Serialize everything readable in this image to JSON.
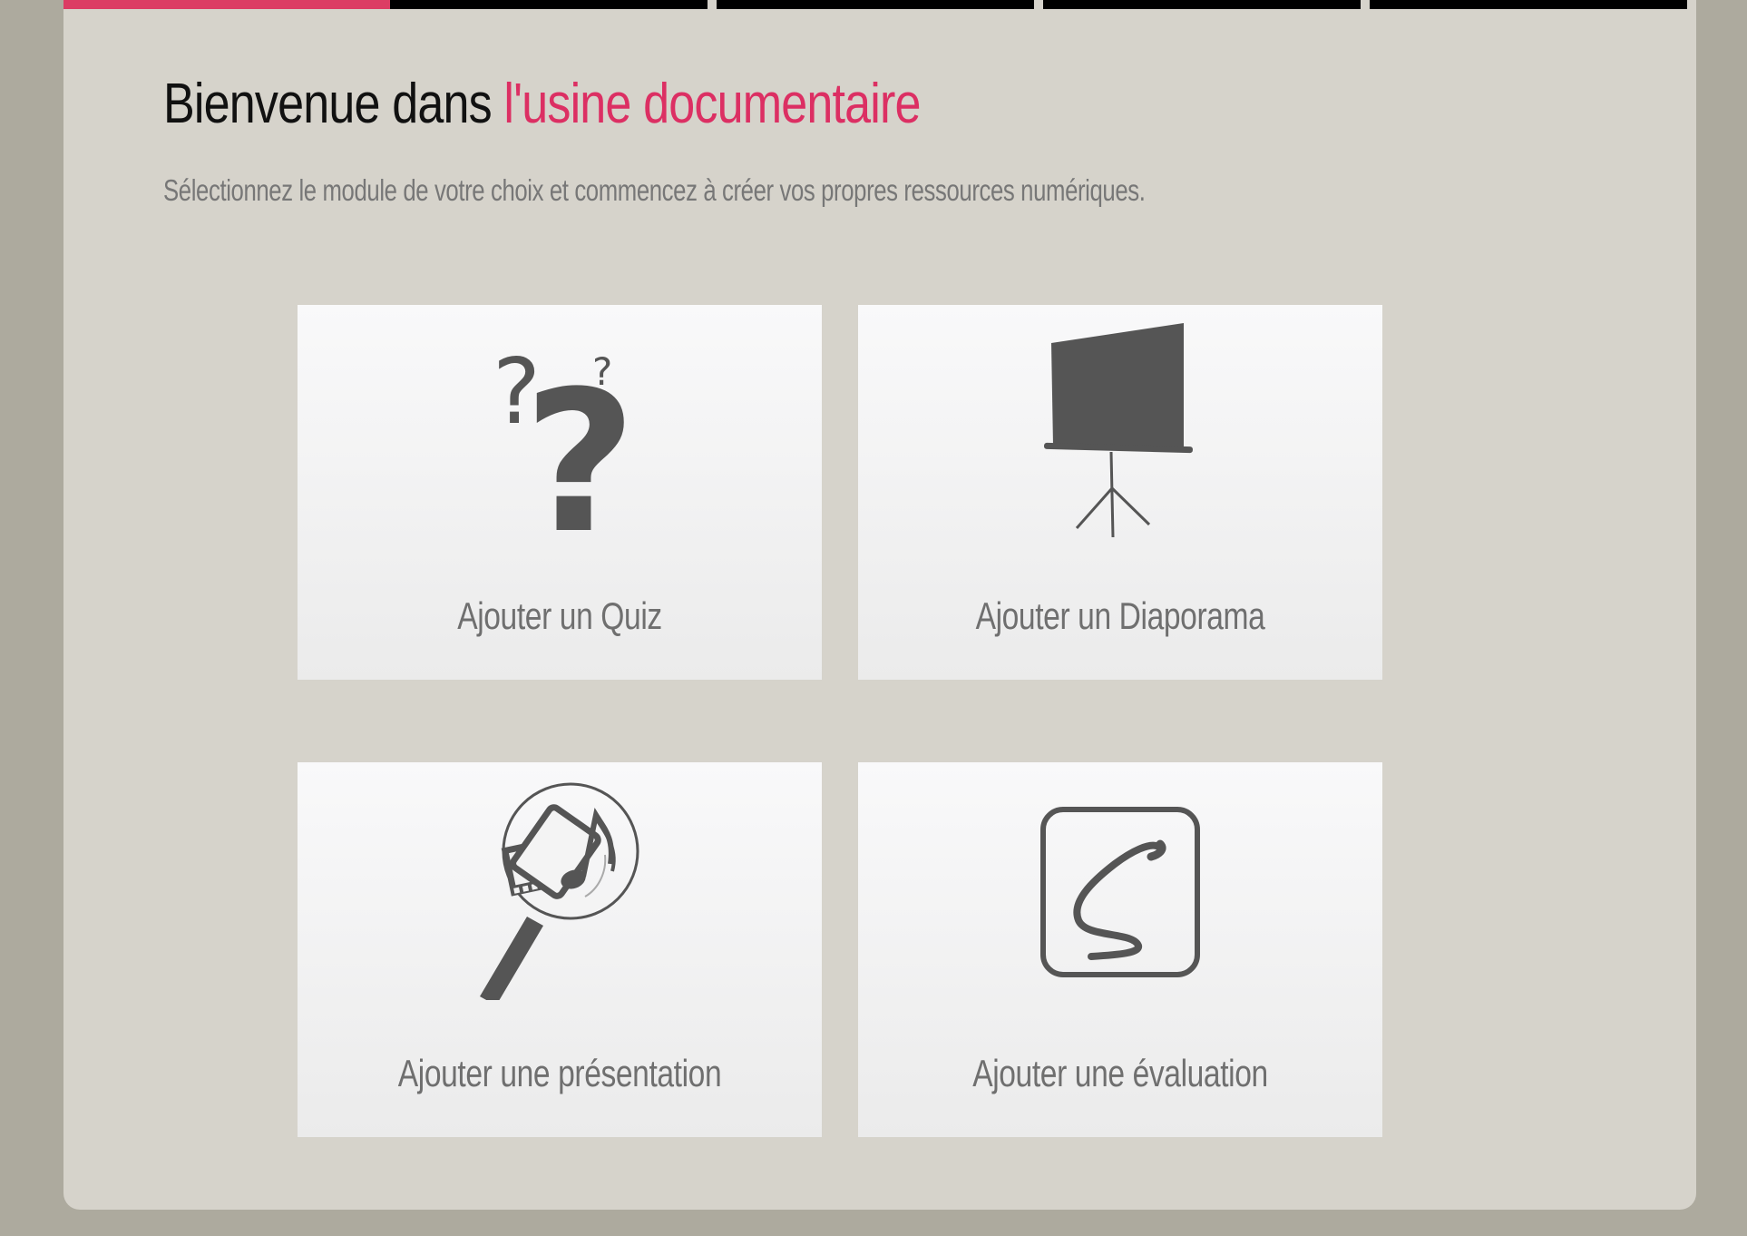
{
  "tabs": [
    {
      "state": "active"
    },
    {
      "state": "inactive"
    },
    {
      "state": "inactive"
    },
    {
      "state": "inactive"
    },
    {
      "state": "inactive"
    }
  ],
  "header": {
    "title_prefix": "Bienvenue dans",
    "title_accent": "l'usine documentaire",
    "subtitle": "Sélectionnez le module de votre choix et commencez à créer vos propres ressources numériques."
  },
  "modules": [
    {
      "label": "Ajouter un Quiz",
      "icon": "question-marks-icon"
    },
    {
      "label": "Ajouter un Diaporama",
      "icon": "projector-screen-icon"
    },
    {
      "label": "Ajouter une présentation",
      "icon": "media-magnifier-icon"
    },
    {
      "label": "Ajouter une évaluation",
      "icon": "signature-box-icon"
    }
  ],
  "colors": {
    "accent": "#dc2f63",
    "tab_active": "#dc3c64",
    "tab_inactive": "#000000",
    "background": "#adaa9e",
    "panel": "#d6d3cb",
    "icon": "#555555"
  }
}
